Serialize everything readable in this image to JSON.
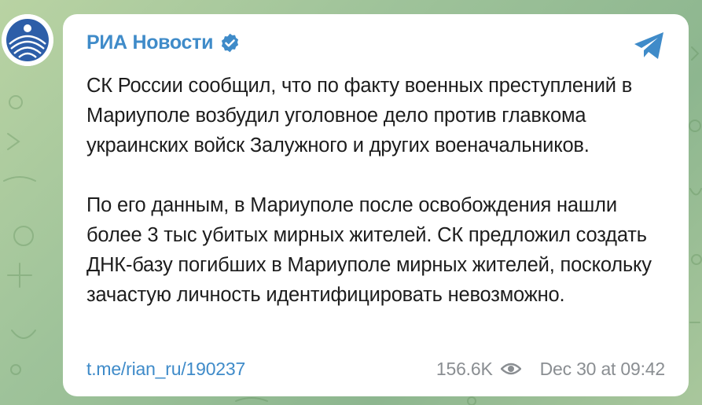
{
  "channel": {
    "name": "РИА Новости",
    "avatar_icon": "ria-logo-icon",
    "verified_icon": "verified-badge-icon",
    "accent_color": "#3f8bc9"
  },
  "message": {
    "paragraph_1": "СК России сообщил, что по факту военных преступлений в Мариуполе возбудил уголовное дело против главкома украинских войск Залужного и других военачальников.",
    "paragraph_2": "По его данным, в Мариуполе после освобождения нашли более 3 тыс убитых мирных жителей. СК предложил создать ДНК-базу погибших в Мариуполе мирных жителей, поскольку зачастую личность идентифицировать невозможно."
  },
  "footer": {
    "link": "t.me/rian_ru/190237",
    "views": "156.6K",
    "views_icon": "eye-icon",
    "timestamp": "Dec 30 at 09:42"
  },
  "share_icon": "telegram-share-icon"
}
